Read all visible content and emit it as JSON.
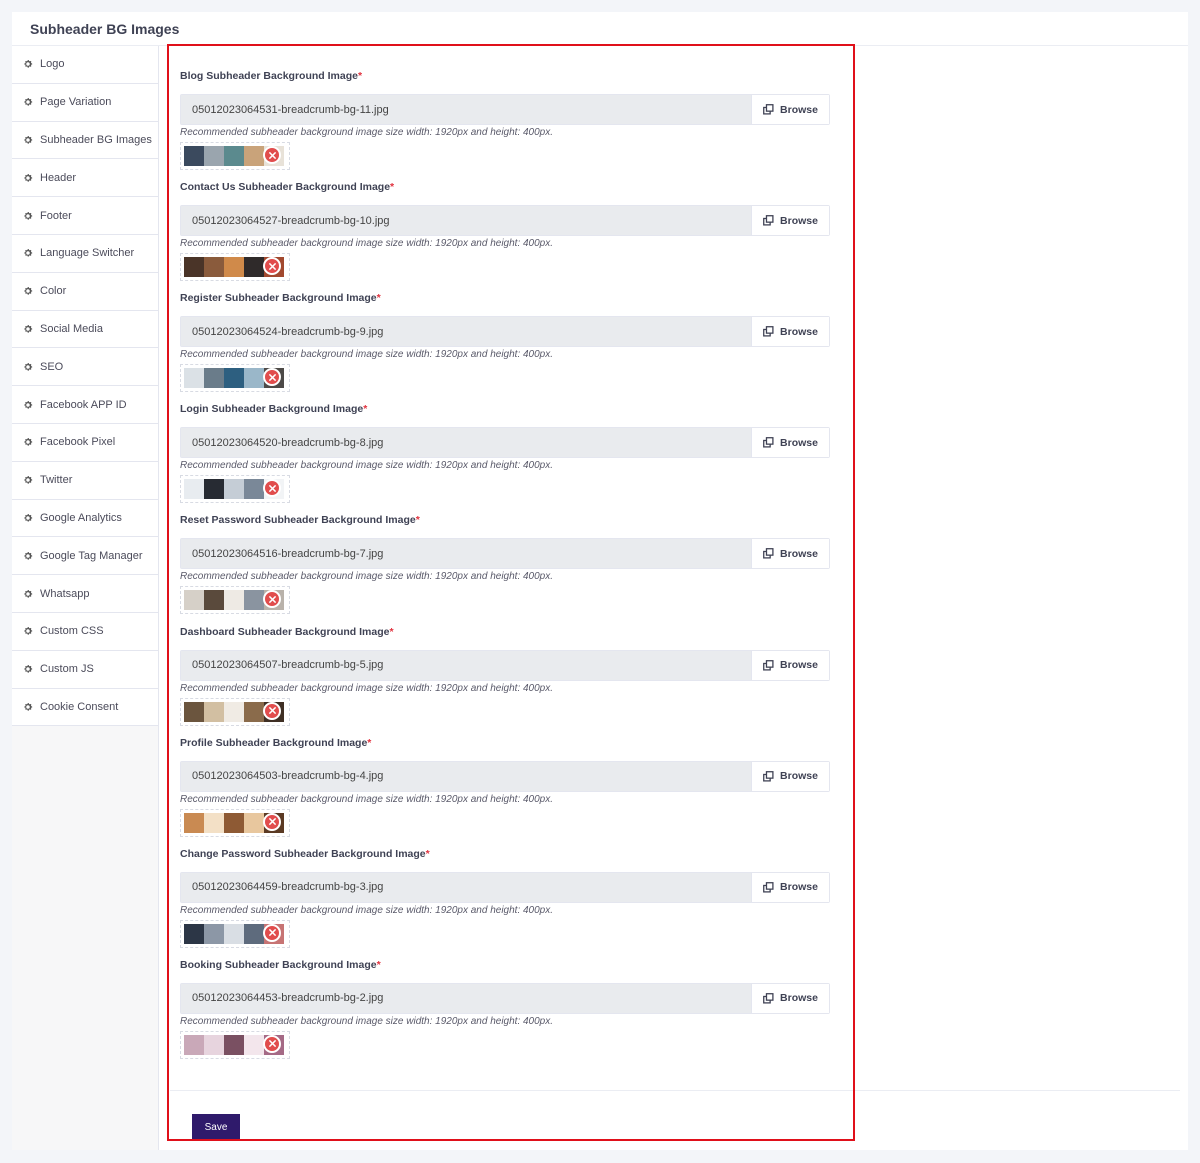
{
  "page": {
    "title": "Subheader BG Images",
    "save_label": "Save"
  },
  "sidebar": {
    "items": [
      {
        "label": "Logo"
      },
      {
        "label": "Page Variation"
      },
      {
        "label": "Subheader BG Images"
      },
      {
        "label": "Header"
      },
      {
        "label": "Footer"
      },
      {
        "label": "Language Switcher"
      },
      {
        "label": "Color"
      },
      {
        "label": "Social Media"
      },
      {
        "label": "SEO"
      },
      {
        "label": "Facebook APP ID"
      },
      {
        "label": "Facebook Pixel"
      },
      {
        "label": "Twitter"
      },
      {
        "label": "Google Analytics"
      },
      {
        "label": "Google Tag Manager"
      },
      {
        "label": "Whatsapp"
      },
      {
        "label": "Custom CSS"
      },
      {
        "label": "Custom JS"
      },
      {
        "label": "Cookie Consent"
      }
    ]
  },
  "fields": [
    {
      "label": "Blog Subheader Background Image",
      "value": "05012023064531-breadcrumb-bg-11.jpg"
    },
    {
      "label": "Contact Us Subheader Background Image",
      "value": "05012023064527-breadcrumb-bg-10.jpg"
    },
    {
      "label": "Register Subheader Background Image",
      "value": "05012023064524-breadcrumb-bg-9.jpg"
    },
    {
      "label": "Login Subheader Background Image",
      "value": "05012023064520-breadcrumb-bg-8.jpg"
    },
    {
      "label": "Reset Password Subheader Background Image",
      "value": "05012023064516-breadcrumb-bg-7.jpg"
    },
    {
      "label": "Dashboard Subheader Background Image",
      "value": "05012023064507-breadcrumb-bg-5.jpg"
    },
    {
      "label": "Profile Subheader Background Image",
      "value": "05012023064503-breadcrumb-bg-4.jpg"
    },
    {
      "label": "Change Password Subheader Background Image",
      "value": "05012023064459-breadcrumb-bg-3.jpg"
    },
    {
      "label": "Booking Subheader Background Image",
      "value": "05012023064453-breadcrumb-bg-2.jpg"
    }
  ],
  "common": {
    "required_mark": "*",
    "browse_label": "Browse",
    "hint": "Recommended subheader background image size width: 1920px and height: 400px.",
    "browse_icon": "copy-icon",
    "remove_icon": "close-icon",
    "sidebar_icon": "gear-icon"
  },
  "colors": {
    "accent_save": "#2f1a6b",
    "required": "#e1333f",
    "remove": "#e14d4d",
    "highlight_border": "#e0101a"
  }
}
